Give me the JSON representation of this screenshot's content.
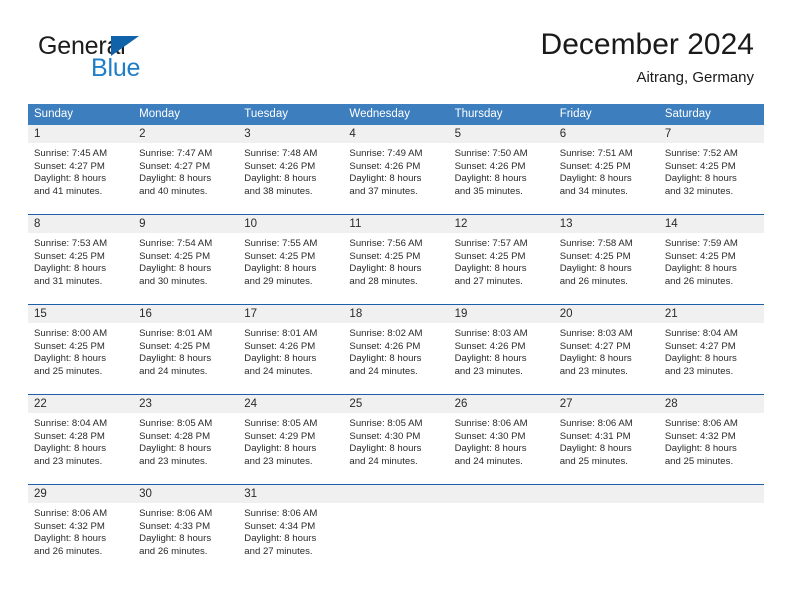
{
  "brand": {
    "name_part1": "General",
    "name_part2": "Blue",
    "triangle_icon": "triangle-icon",
    "accent_color": "#1e7ec8",
    "dark_color": "#1063a8"
  },
  "header": {
    "month_title": "December 2024",
    "location": "Aitrang, Germany"
  },
  "calendar": {
    "header_bg_color": "#3c7ebe",
    "row_divider_color": "#1f5fa8",
    "day_band_color": "#f0f0f0",
    "weekdays": [
      "Sunday",
      "Monday",
      "Tuesday",
      "Wednesday",
      "Thursday",
      "Friday",
      "Saturday"
    ],
    "weeks": [
      [
        {
          "day": "1",
          "sunrise": "Sunrise: 7:45 AM",
          "sunset": "Sunset: 4:27 PM",
          "daylight_line1": "Daylight: 8 hours",
          "daylight_line2": "and 41 minutes."
        },
        {
          "day": "2",
          "sunrise": "Sunrise: 7:47 AM",
          "sunset": "Sunset: 4:27 PM",
          "daylight_line1": "Daylight: 8 hours",
          "daylight_line2": "and 40 minutes."
        },
        {
          "day": "3",
          "sunrise": "Sunrise: 7:48 AM",
          "sunset": "Sunset: 4:26 PM",
          "daylight_line1": "Daylight: 8 hours",
          "daylight_line2": "and 38 minutes."
        },
        {
          "day": "4",
          "sunrise": "Sunrise: 7:49 AM",
          "sunset": "Sunset: 4:26 PM",
          "daylight_line1": "Daylight: 8 hours",
          "daylight_line2": "and 37 minutes."
        },
        {
          "day": "5",
          "sunrise": "Sunrise: 7:50 AM",
          "sunset": "Sunset: 4:26 PM",
          "daylight_line1": "Daylight: 8 hours",
          "daylight_line2": "and 35 minutes."
        },
        {
          "day": "6",
          "sunrise": "Sunrise: 7:51 AM",
          "sunset": "Sunset: 4:25 PM",
          "daylight_line1": "Daylight: 8 hours",
          "daylight_line2": "and 34 minutes."
        },
        {
          "day": "7",
          "sunrise": "Sunrise: 7:52 AM",
          "sunset": "Sunset: 4:25 PM",
          "daylight_line1": "Daylight: 8 hours",
          "daylight_line2": "and 32 minutes."
        }
      ],
      [
        {
          "day": "8",
          "sunrise": "Sunrise: 7:53 AM",
          "sunset": "Sunset: 4:25 PM",
          "daylight_line1": "Daylight: 8 hours",
          "daylight_line2": "and 31 minutes."
        },
        {
          "day": "9",
          "sunrise": "Sunrise: 7:54 AM",
          "sunset": "Sunset: 4:25 PM",
          "daylight_line1": "Daylight: 8 hours",
          "daylight_line2": "and 30 minutes."
        },
        {
          "day": "10",
          "sunrise": "Sunrise: 7:55 AM",
          "sunset": "Sunset: 4:25 PM",
          "daylight_line1": "Daylight: 8 hours",
          "daylight_line2": "and 29 minutes."
        },
        {
          "day": "11",
          "sunrise": "Sunrise: 7:56 AM",
          "sunset": "Sunset: 4:25 PM",
          "daylight_line1": "Daylight: 8 hours",
          "daylight_line2": "and 28 minutes."
        },
        {
          "day": "12",
          "sunrise": "Sunrise: 7:57 AM",
          "sunset": "Sunset: 4:25 PM",
          "daylight_line1": "Daylight: 8 hours",
          "daylight_line2": "and 27 minutes."
        },
        {
          "day": "13",
          "sunrise": "Sunrise: 7:58 AM",
          "sunset": "Sunset: 4:25 PM",
          "daylight_line1": "Daylight: 8 hours",
          "daylight_line2": "and 26 minutes."
        },
        {
          "day": "14",
          "sunrise": "Sunrise: 7:59 AM",
          "sunset": "Sunset: 4:25 PM",
          "daylight_line1": "Daylight: 8 hours",
          "daylight_line2": "and 26 minutes."
        }
      ],
      [
        {
          "day": "15",
          "sunrise": "Sunrise: 8:00 AM",
          "sunset": "Sunset: 4:25 PM",
          "daylight_line1": "Daylight: 8 hours",
          "daylight_line2": "and 25 minutes."
        },
        {
          "day": "16",
          "sunrise": "Sunrise: 8:01 AM",
          "sunset": "Sunset: 4:25 PM",
          "daylight_line1": "Daylight: 8 hours",
          "daylight_line2": "and 24 minutes."
        },
        {
          "day": "17",
          "sunrise": "Sunrise: 8:01 AM",
          "sunset": "Sunset: 4:26 PM",
          "daylight_line1": "Daylight: 8 hours",
          "daylight_line2": "and 24 minutes."
        },
        {
          "day": "18",
          "sunrise": "Sunrise: 8:02 AM",
          "sunset": "Sunset: 4:26 PM",
          "daylight_line1": "Daylight: 8 hours",
          "daylight_line2": "and 24 minutes."
        },
        {
          "day": "19",
          "sunrise": "Sunrise: 8:03 AM",
          "sunset": "Sunset: 4:26 PM",
          "daylight_line1": "Daylight: 8 hours",
          "daylight_line2": "and 23 minutes."
        },
        {
          "day": "20",
          "sunrise": "Sunrise: 8:03 AM",
          "sunset": "Sunset: 4:27 PM",
          "daylight_line1": "Daylight: 8 hours",
          "daylight_line2": "and 23 minutes."
        },
        {
          "day": "21",
          "sunrise": "Sunrise: 8:04 AM",
          "sunset": "Sunset: 4:27 PM",
          "daylight_line1": "Daylight: 8 hours",
          "daylight_line2": "and 23 minutes."
        }
      ],
      [
        {
          "day": "22",
          "sunrise": "Sunrise: 8:04 AM",
          "sunset": "Sunset: 4:28 PM",
          "daylight_line1": "Daylight: 8 hours",
          "daylight_line2": "and 23 minutes."
        },
        {
          "day": "23",
          "sunrise": "Sunrise: 8:05 AM",
          "sunset": "Sunset: 4:28 PM",
          "daylight_line1": "Daylight: 8 hours",
          "daylight_line2": "and 23 minutes."
        },
        {
          "day": "24",
          "sunrise": "Sunrise: 8:05 AM",
          "sunset": "Sunset: 4:29 PM",
          "daylight_line1": "Daylight: 8 hours",
          "daylight_line2": "and 23 minutes."
        },
        {
          "day": "25",
          "sunrise": "Sunrise: 8:05 AM",
          "sunset": "Sunset: 4:30 PM",
          "daylight_line1": "Daylight: 8 hours",
          "daylight_line2": "and 24 minutes."
        },
        {
          "day": "26",
          "sunrise": "Sunrise: 8:06 AM",
          "sunset": "Sunset: 4:30 PM",
          "daylight_line1": "Daylight: 8 hours",
          "daylight_line2": "and 24 minutes."
        },
        {
          "day": "27",
          "sunrise": "Sunrise: 8:06 AM",
          "sunset": "Sunset: 4:31 PM",
          "daylight_line1": "Daylight: 8 hours",
          "daylight_line2": "and 25 minutes."
        },
        {
          "day": "28",
          "sunrise": "Sunrise: 8:06 AM",
          "sunset": "Sunset: 4:32 PM",
          "daylight_line1": "Daylight: 8 hours",
          "daylight_line2": "and 25 minutes."
        }
      ],
      [
        {
          "day": "29",
          "sunrise": "Sunrise: 8:06 AM",
          "sunset": "Sunset: 4:32 PM",
          "daylight_line1": "Daylight: 8 hours",
          "daylight_line2": "and 26 minutes."
        },
        {
          "day": "30",
          "sunrise": "Sunrise: 8:06 AM",
          "sunset": "Sunset: 4:33 PM",
          "daylight_line1": "Daylight: 8 hours",
          "daylight_line2": "and 26 minutes."
        },
        {
          "day": "31",
          "sunrise": "Sunrise: 8:06 AM",
          "sunset": "Sunset: 4:34 PM",
          "daylight_line1": "Daylight: 8 hours",
          "daylight_line2": "and 27 minutes."
        },
        {
          "day": "",
          "sunrise": "",
          "sunset": "",
          "daylight_line1": "",
          "daylight_line2": ""
        },
        {
          "day": "",
          "sunrise": "",
          "sunset": "",
          "daylight_line1": "",
          "daylight_line2": ""
        },
        {
          "day": "",
          "sunrise": "",
          "sunset": "",
          "daylight_line1": "",
          "daylight_line2": ""
        },
        {
          "day": "",
          "sunrise": "",
          "sunset": "",
          "daylight_line1": "",
          "daylight_line2": ""
        }
      ]
    ]
  }
}
